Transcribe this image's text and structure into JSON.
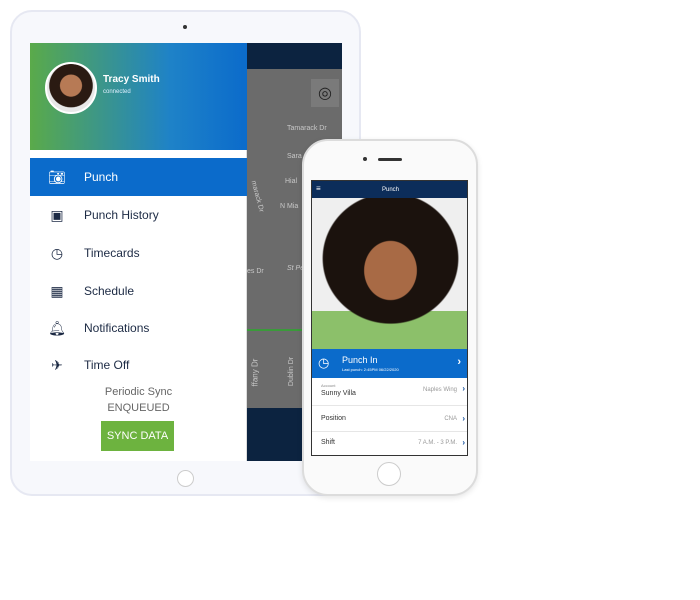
{
  "tablet": {
    "user": {
      "name": "Tracy Smith",
      "status": "connected"
    },
    "menu": [
      {
        "label": "Punch",
        "icon": "camera-icon",
        "active": true
      },
      {
        "label": "Punch History",
        "icon": "photo-icon"
      },
      {
        "label": "Timecards",
        "icon": "clock-icon"
      },
      {
        "label": "Schedule",
        "icon": "calendar-icon"
      },
      {
        "label": "Notifications",
        "icon": "bell-icon"
      },
      {
        "label": "Time Off",
        "icon": "airplane-icon"
      }
    ],
    "sync": {
      "label": "Periodic Sync",
      "status": "ENQUEUED",
      "button": "SYNC DATA"
    },
    "map_labels": [
      "Tamarack Dr",
      "Sara",
      "Hial",
      "N Mia",
      "marack Dr",
      "es Dr",
      "St Pe",
      "ffany Dr",
      "Dublin Dr"
    ]
  },
  "phone": {
    "title": "Punch",
    "punch": {
      "label": "Punch In",
      "last": "Last punch: 2:45PM 06/22/2020"
    },
    "rows": [
      {
        "caption": "Account",
        "label": "Sunny Villa",
        "value": "Naples Wing"
      },
      {
        "label": "Position",
        "value": "CNA"
      },
      {
        "label": "Shift",
        "value": "7 A.M. - 3 P.M."
      }
    ]
  },
  "colors": {
    "navy": "#0c2340",
    "blue": "#0b6bcb",
    "green": "#6db33f"
  }
}
